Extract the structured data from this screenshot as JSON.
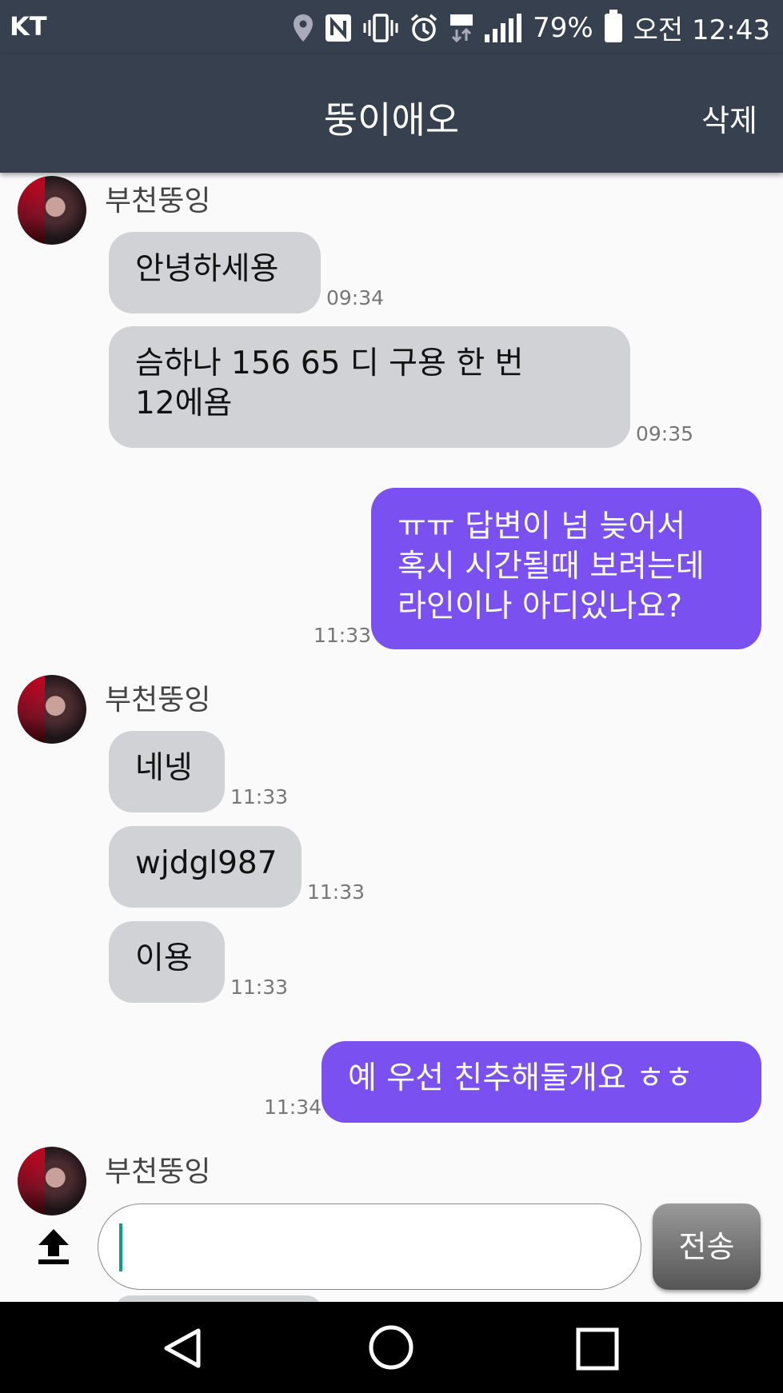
{
  "status_bar": {
    "carrier": "KT",
    "battery_percent": "79%",
    "time": "오전 12:43",
    "icons": [
      "location-icon",
      "nfc-icon",
      "vibrate-icon",
      "alarm-icon",
      "lte-icon",
      "signal-icon",
      "battery-icon"
    ]
  },
  "app_bar": {
    "title": "뚱이애오",
    "delete_label": "삭제"
  },
  "messages": [
    {
      "sender": "부천뚱잉"
    },
    {
      "text": "안녕하세용",
      "time": "09:34"
    },
    {
      "text_line1": "슴하나 156 65 디 구용 한 번",
      "text_line2": "12에욤",
      "time": "09:35"
    },
    {
      "text_line1": "ㅠㅠ   답변이 넘 늦어서",
      "text_line2": "혹시 시간될때 보려는데",
      "text_line3": "라인이나 아디있나요?",
      "time": "11:33"
    },
    {
      "sender": "부천뚱잉"
    },
    {
      "text": "네넹",
      "time": "11:33"
    },
    {
      "text": "wjdgl987",
      "time": "11:33"
    },
    {
      "text": "이용",
      "time": "11:33"
    },
    {
      "text": "예  우선 친추해둘개요 ㅎㅎ",
      "time": "11:34"
    },
    {
      "sender": "부천뚱잉"
    }
  ],
  "composer": {
    "value": "",
    "send_label": "전송",
    "upload_icon": "upload-icon"
  },
  "nav": {
    "icons": [
      "back-icon",
      "home-icon",
      "recents-icon"
    ]
  },
  "colors": {
    "bar": "#37404f",
    "outgoing": "#7a50f0",
    "incoming": "#d0d2d6"
  }
}
